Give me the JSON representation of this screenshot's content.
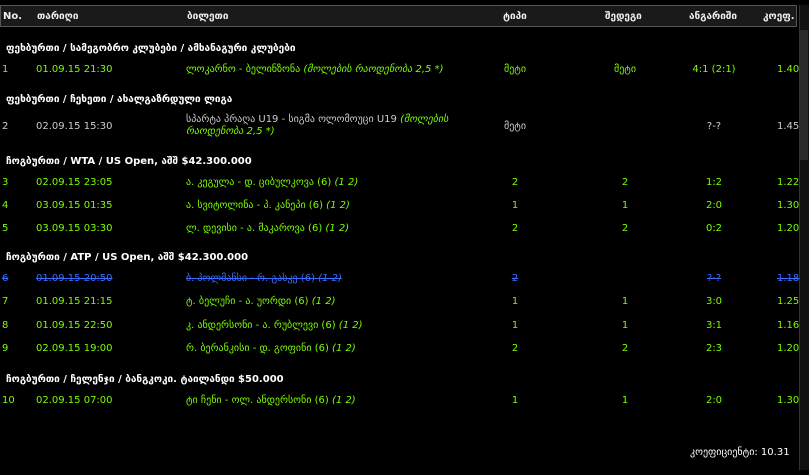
{
  "header": {
    "no": "No.",
    "date": "თარიღი",
    "match": "ბილეთი",
    "type": "ტიპი",
    "choice": "შედეგი",
    "score": "ანგარიში",
    "odds": "კოეფ."
  },
  "sections": [
    {
      "title": "ფეხბურთი / სამეგობრო კლუბები / ამხანაგური კლუბები"
    },
    {
      "title": "ფეხბურთი / ჩეხეთი / ახალგაზრდული ლიგა"
    },
    {
      "title": "ჩოგბურთი / WTA / US Open, აშშ $42.300.000"
    },
    {
      "title": "ჩოგბურთი / ATP / US Open, აშშ $42.300.000"
    },
    {
      "title": "ჩოგბურთი / ჩელენჯი / ბანგკოკი. ტაილანდი $50.000"
    }
  ],
  "rows": [
    {
      "no": "1",
      "date": "01.09.15 21:30",
      "match": "ლოკარნო - ბელინზონა",
      "note": "(მოლების რაოდენობა 2,5 *)",
      "type": "მეტი",
      "choice": "მეტი",
      "score": "4:1 (2:1)",
      "odds": "1.40"
    },
    {
      "no": "2",
      "date": "02.09.15 15:30",
      "match": "სპარტა პრაღა U19 - სიგმა ოლომოუცი U19",
      "note": "(მოლების რაოდენობა 2,5 *)",
      "type": "მეტი",
      "choice": "",
      "score": "?-?",
      "odds": "1.45"
    },
    {
      "no": "3",
      "date": "02.09.15 23:05",
      "match": "ა. კეგულა - დ. ციბულკოვა (6)",
      "note": "(1 2)",
      "type": "2",
      "choice": "2",
      "score": "1:2",
      "odds": "1.22"
    },
    {
      "no": "4",
      "date": "03.09.15 01:35",
      "match": "ა. სვიტოლინა - პ. კანეპი (6)",
      "note": "(1 2)",
      "type": "1",
      "choice": "1",
      "score": "2:0",
      "odds": "1.30"
    },
    {
      "no": "5",
      "date": "03.09.15 03:30",
      "match": "ლ. დევისი - ა. მაკაროვა (6)",
      "note": "(1 2)",
      "type": "2",
      "choice": "2",
      "score": "0:2",
      "odds": "1.20"
    },
    {
      "no": "6",
      "date": "01.09.15 20:50",
      "match": "ბ. პოლმანსი - რ. გასკე (6)",
      "note": "(1 2)",
      "type": "2",
      "choice": "",
      "score": "?-?",
      "odds": "1.18"
    },
    {
      "no": "7",
      "date": "01.09.15 21:15",
      "match": "ტ. ბელუჩი - ა. უორდი (6)",
      "note": "(1 2)",
      "type": "1",
      "choice": "1",
      "score": "3:0",
      "odds": "1.25"
    },
    {
      "no": "8",
      "date": "01.09.15 22:50",
      "match": "კ. ანდერსონი - ა. რუბლევი (6)",
      "note": "(1 2)",
      "type": "1",
      "choice": "1",
      "score": "3:1",
      "odds": "1.16"
    },
    {
      "no": "9",
      "date": "02.09.15 19:00",
      "match": "რ. ბერანკისი - დ. გოფინი (6)",
      "note": "(1 2)",
      "type": "2",
      "choice": "2",
      "score": "2:3",
      "odds": "1.20"
    },
    {
      "no": "10",
      "date": "02.09.15 07:00",
      "match": "ტი ჩენი - ოლ. ანდერსონი (6)",
      "note": "(1 2)",
      "type": "1",
      "choice": "1",
      "score": "2:0",
      "odds": "1.30"
    }
  ],
  "footer": {
    "total": "კოეფიციენტი: 10.31"
  },
  "colors": {
    "accent": "#7CFC00",
    "cancelled": "#3a6cff",
    "background": "#000000"
  }
}
